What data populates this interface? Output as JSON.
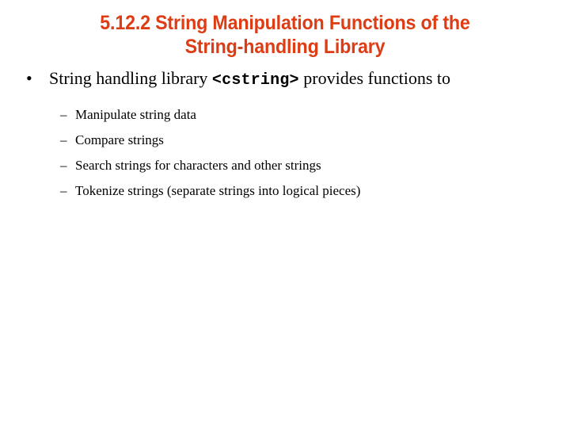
{
  "slide": {
    "background_color": "#ffffff",
    "title": {
      "color": "#dd3c14",
      "lines": [
        "5.12.2 String Manipulation Functions of the",
        "String-handling Library"
      ]
    },
    "body": {
      "text_color": "#000000",
      "bullet_marker": "•",
      "sub_bullet_marker": "–",
      "bullets": [
        {
          "text_before_code": "String handling library ",
          "code": "<cstring>",
          "text_after_code": " provides functions to",
          "sub_bullets": [
            "Manipulate string data",
            "Compare strings",
            "Search strings for characters and other strings",
            "Tokenize strings (separate strings into logical pieces)"
          ]
        }
      ]
    }
  }
}
